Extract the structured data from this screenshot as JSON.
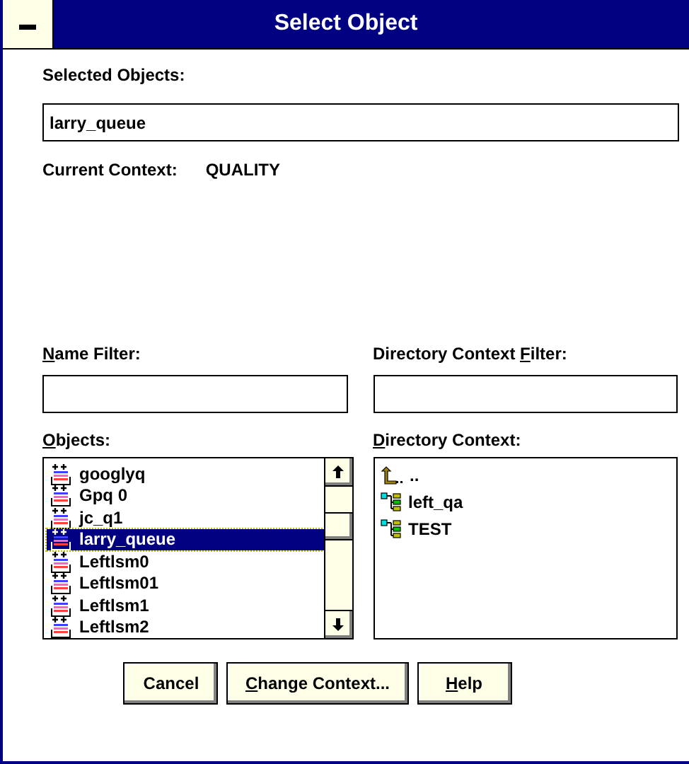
{
  "window": {
    "title": "Select Object",
    "system_menu": "▬"
  },
  "selected_objects": {
    "label": "Selected Objects:",
    "value": "larry_queue"
  },
  "current_context": {
    "label": "Current Context:",
    "value": "QUALITY"
  },
  "name_filter": {
    "label": [
      {
        "text": "N",
        "underlined": true
      },
      {
        "text": "ame Filter:",
        "underlined": false
      }
    ]
  },
  "directory_context_filter": {
    "label": [
      {
        "text": "Directory Context ",
        "underlined": false
      },
      {
        "text": "F",
        "underlined": true
      },
      {
        "text": "ilter:",
        "underlined": false
      }
    ]
  },
  "objects": {
    "label": [
      {
        "text": "O",
        "underlined": true
      },
      {
        "text": "bjects:",
        "underlined": false
      }
    ],
    "items": [
      {
        "name": "googlyq",
        "selected": false
      },
      {
        "name": "Gpq 0",
        "selected": false
      },
      {
        "name": "jc_q1",
        "selected": false
      },
      {
        "name": "larry_queue",
        "selected": true
      },
      {
        "name": "Leftlsm0",
        "selected": false
      },
      {
        "name": "Leftlsm01",
        "selected": false
      },
      {
        "name": "Leftlsm1",
        "selected": false
      },
      {
        "name": "Leftlsm2",
        "selected": false
      }
    ]
  },
  "directory_context": {
    "label": [
      {
        "text": "D",
        "underlined": true
      },
      {
        "text": "irectory Context:",
        "underlined": false
      }
    ],
    "items": [
      {
        "name": "..",
        "kind": "parent"
      },
      {
        "name": "left_qa",
        "kind": "context"
      },
      {
        "name": "TEST",
        "kind": "context"
      }
    ]
  },
  "buttons": [
    {
      "label": [
        {
          "text": "Cancel",
          "underlined": false
        }
      ]
    },
    {
      "label": [
        {
          "text": "C",
          "underlined": true
        },
        {
          "text": "hange Context...",
          "underlined": false
        }
      ]
    },
    {
      "label": [
        {
          "text": "H",
          "underlined": true
        },
        {
          "text": "elp",
          "underlined": false
        }
      ]
    }
  ]
}
